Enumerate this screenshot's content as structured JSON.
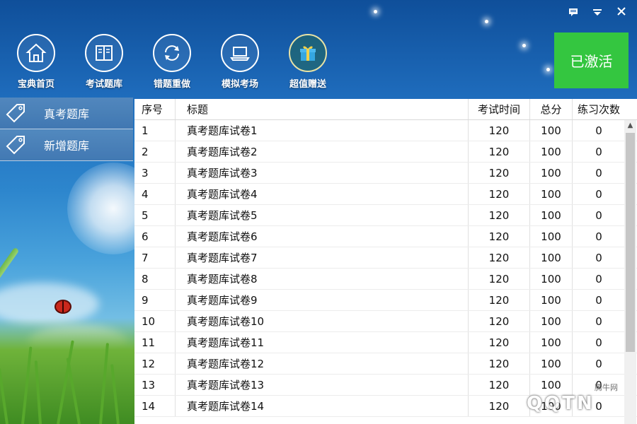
{
  "window_controls": {
    "feedback_icon": "message-icon",
    "menu_icon": "dropdown-icon",
    "close_icon": "close-icon"
  },
  "toolbar": [
    {
      "label": "宝典首页",
      "icon": "home-icon"
    },
    {
      "label": "考试题库",
      "icon": "book-icon"
    },
    {
      "label": "错题重做",
      "icon": "refresh-icon"
    },
    {
      "label": "模拟考场",
      "icon": "laptop-icon"
    },
    {
      "label": "超值赠送",
      "icon": "gift-icon"
    }
  ],
  "activated_label": "已激活",
  "colors": {
    "activated_bg": "#34c640"
  },
  "sidebar": [
    {
      "label": "真考题库",
      "icon": "tag-icon"
    },
    {
      "label": "新增题库",
      "icon": "tag-icon"
    }
  ],
  "table": {
    "headers": [
      "序号",
      "标题",
      "考试时间",
      "总分",
      "练习次数"
    ],
    "rows": [
      [
        "1",
        "真考题库试卷1",
        "120",
        "100",
        "0"
      ],
      [
        "2",
        "真考题库试卷2",
        "120",
        "100",
        "0"
      ],
      [
        "3",
        "真考题库试卷3",
        "120",
        "100",
        "0"
      ],
      [
        "4",
        "真考题库试卷4",
        "120",
        "100",
        "0"
      ],
      [
        "5",
        "真考题库试卷5",
        "120",
        "100",
        "0"
      ],
      [
        "6",
        "真考题库试卷6",
        "120",
        "100",
        "0"
      ],
      [
        "7",
        "真考题库试卷7",
        "120",
        "100",
        "0"
      ],
      [
        "8",
        "真考题库试卷8",
        "120",
        "100",
        "0"
      ],
      [
        "9",
        "真考题库试卷9",
        "120",
        "100",
        "0"
      ],
      [
        "10",
        "真考题库试卷10",
        "120",
        "100",
        "0"
      ],
      [
        "11",
        "真考题库试卷11",
        "120",
        "100",
        "0"
      ],
      [
        "12",
        "真考题库试卷12",
        "120",
        "100",
        "0"
      ],
      [
        "13",
        "真考题库试卷13",
        "120",
        "100",
        "0"
      ],
      [
        "14",
        "真考题库试卷14",
        "120",
        "100",
        "0"
      ]
    ]
  },
  "watermark": {
    "text": "QQTN",
    "small": "腾牛网"
  }
}
